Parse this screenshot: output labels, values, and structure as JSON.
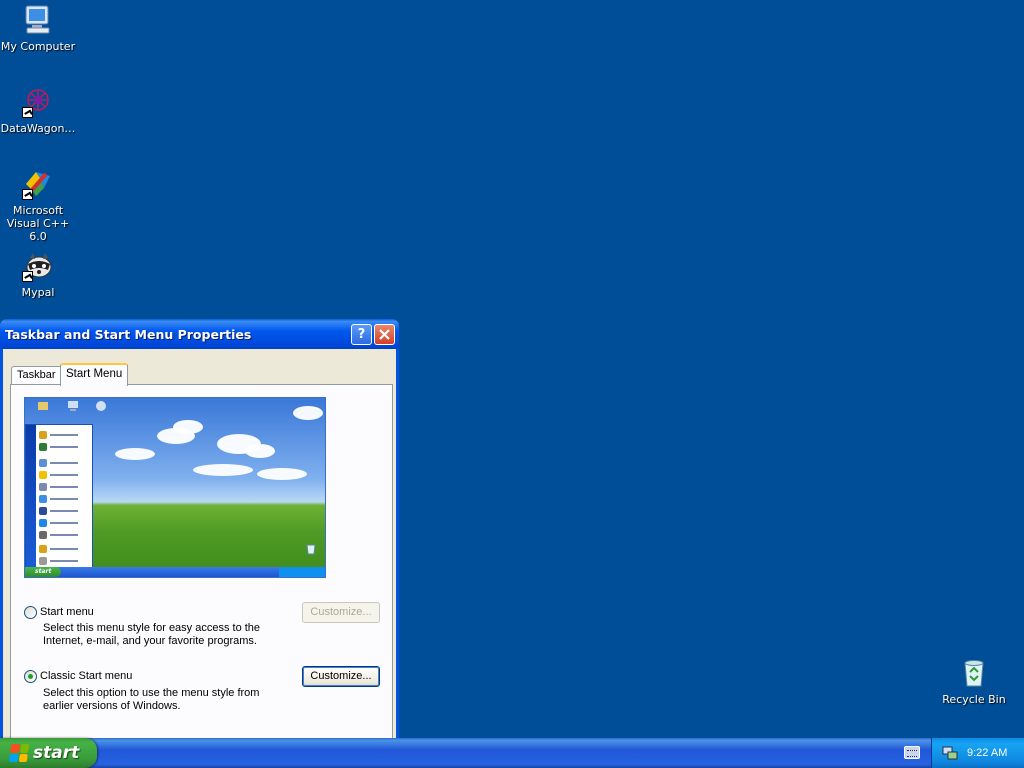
{
  "desktop": {
    "icons": [
      {
        "label": "My Computer",
        "icon": "my-computer-icon"
      },
      {
        "label": "DataWagon…",
        "icon": "datawagon-icon"
      },
      {
        "label": "Microsoft Visual C++ 6.0",
        "icon": "visual-cpp-icon"
      },
      {
        "label": "Mypal",
        "icon": "mypal-icon"
      },
      {
        "label": "Recycle Bin",
        "icon": "recycle-bin-icon"
      }
    ],
    "background_color": "#004e98"
  },
  "dialog": {
    "title": "Taskbar and Start Menu Properties",
    "help_button": "?",
    "close_button": "✕",
    "tabs": [
      {
        "label": "Taskbar",
        "selected": false
      },
      {
        "label": "Start Menu",
        "selected": true
      }
    ],
    "preview": {
      "start_label": "start"
    },
    "options": [
      {
        "label": "Start menu",
        "description": "Select this menu style for easy access to the Internet, e-mail, and your favorite programs.",
        "checked": false,
        "customize_label": "Customize...",
        "customize_enabled": false
      },
      {
        "label": "Classic Start menu",
        "description": "Select this option to use the menu style from earlier versions of Windows.",
        "checked": true,
        "customize_label": "Customize...",
        "customize_enabled": true
      }
    ]
  },
  "taskbar": {
    "start_label": "start",
    "clock": "9:22 AM",
    "tray_icons": [
      "keyboard-icon",
      "network-icon"
    ],
    "colors": {
      "taskbar": "#245edb",
      "start": "#3a9b3a",
      "tray": "#0f86e0"
    }
  }
}
